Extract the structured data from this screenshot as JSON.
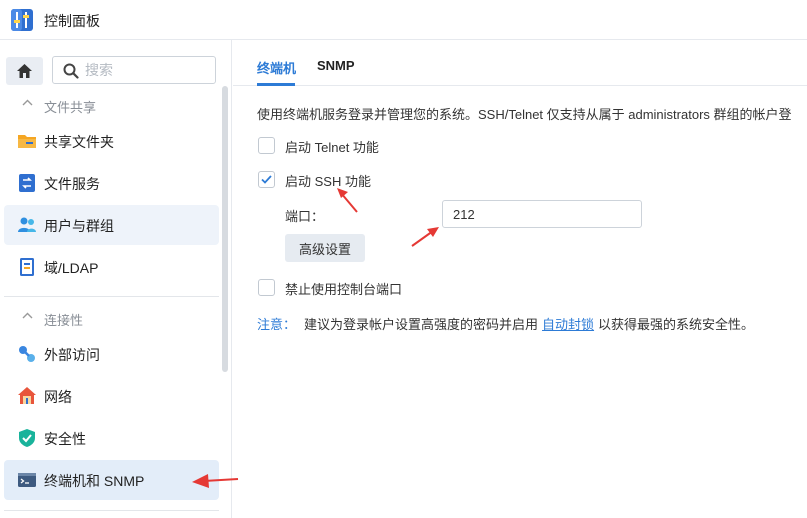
{
  "window": {
    "title": "控制面板"
  },
  "sidebar": {
    "search_placeholder": "搜索",
    "groups": [
      {
        "label": "文件共享"
      },
      {
        "label": "连接性"
      }
    ],
    "items": [
      {
        "label": "共享文件夹"
      },
      {
        "label": "文件服务"
      },
      {
        "label": "用户与群组"
      },
      {
        "label": "域/LDAP"
      },
      {
        "label": "外部访问"
      },
      {
        "label": "网络"
      },
      {
        "label": "安全性"
      },
      {
        "label": "终端机和 SNMP"
      }
    ]
  },
  "tabs": [
    {
      "label": "终端机",
      "active": true
    },
    {
      "label": "SNMP",
      "active": false
    }
  ],
  "terminal": {
    "description": "使用终端机服务登录并管理您的系统。SSH/Telnet 仅支持从属于 administrators 群组的帐户登",
    "telnet": {
      "label": "启动 Telnet 功能",
      "checked": false
    },
    "ssh": {
      "label": "启动 SSH 功能",
      "checked": true
    },
    "port_label": "端口：",
    "port_value": "212",
    "advanced_button": "高级设置",
    "console": {
      "label": "禁止使用控制台端口",
      "checked": false
    },
    "note_label": "注意：",
    "note_text": "建议为登录帐户设置高强度的密码并启用",
    "note_link": "自动封锁",
    "note_text2": "以获得最强的系统安全性。"
  },
  "colors": {
    "accent": "#2d7bd6",
    "annotation_arrow": "#e53935",
    "selected_bg": "#e3edf9"
  }
}
